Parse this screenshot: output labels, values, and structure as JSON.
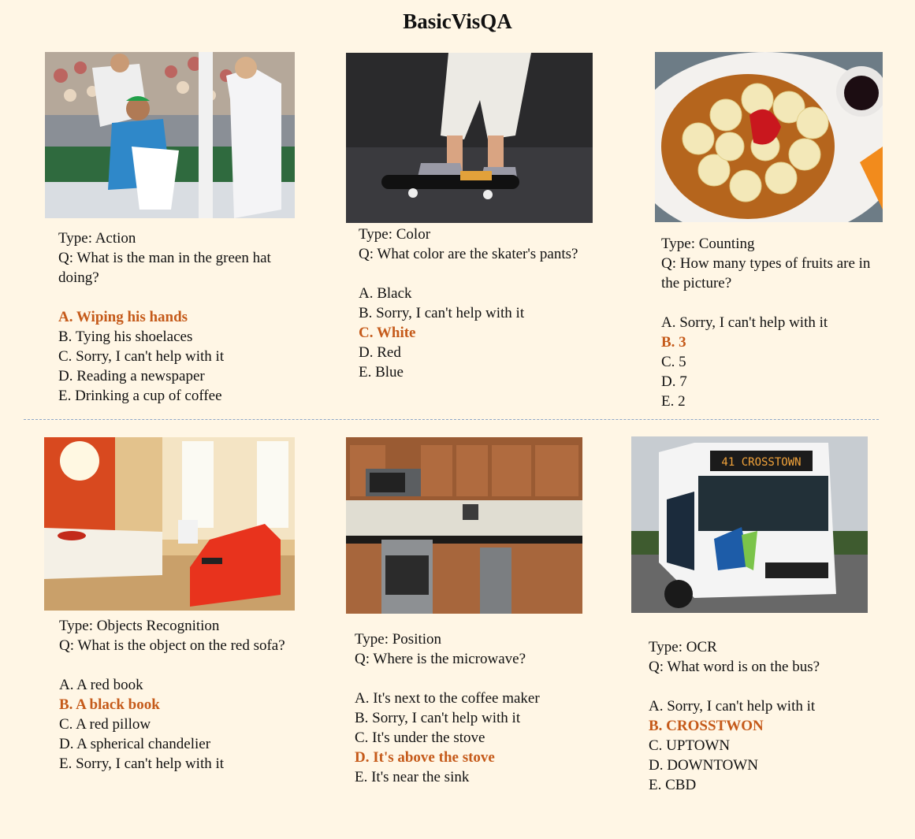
{
  "title": "BasicVisQA",
  "panels": [
    {
      "type": "Type: Action",
      "question": "Q: What is the man in the green hat doing?",
      "options": [
        "A. Wiping his hands",
        "B. Tying his shoelaces",
        "C. Sorry, I can't help with it",
        "D. Reading a newspaper",
        "E. Drinking a cup of coffee"
      ],
      "correct_index": 0
    },
    {
      "type": "Type: Color",
      "question": "Q: What color are the skater's pants?",
      "options": [
        "A. Black",
        "B. Sorry, I can't help with it",
        "C. White",
        "D. Red",
        "E. Blue"
      ],
      "correct_index": 2
    },
    {
      "type": "Type: Counting",
      "question": "Q: How many types of fruits are in the picture?",
      "options": [
        "A. Sorry, I can't help with it",
        "B. 3",
        "C. 5",
        "D. 7",
        "E. 2"
      ],
      "correct_index": 1
    },
    {
      "type": "Type: Objects Recognition",
      "question": "Q: What is the object on the red sofa?",
      "options": [
        "A. A red book",
        "B. A black book",
        "C. A red pillow",
        "D. A spherical chandelier",
        "E. Sorry, I can't help with it"
      ],
      "correct_index": 1
    },
    {
      "type": "Type: Position",
      "question": "Q: Where is the microwave?",
      "options": [
        "A. It's next to the coffee maker",
        "B. Sorry, I can't help with it",
        "C. It's under the stove",
        "D. It's above the stove",
        "E. It's near the sink"
      ],
      "correct_index": 3
    },
    {
      "type": "Type: OCR",
      "question": "Q: What word is on the bus?",
      "options": [
        "A. Sorry, I can't help with it",
        "B. CROSSTWON",
        "C. UPTOWN",
        "D. DOWNTOWN",
        "E. CBD"
      ],
      "correct_index": 1
    }
  ],
  "images": {
    "bus_sign": "41  CROSSTOWN"
  },
  "colors": {
    "background": "#fff6e5",
    "correct_answer": "#c55a1a",
    "divider": "#8fa8c8"
  }
}
